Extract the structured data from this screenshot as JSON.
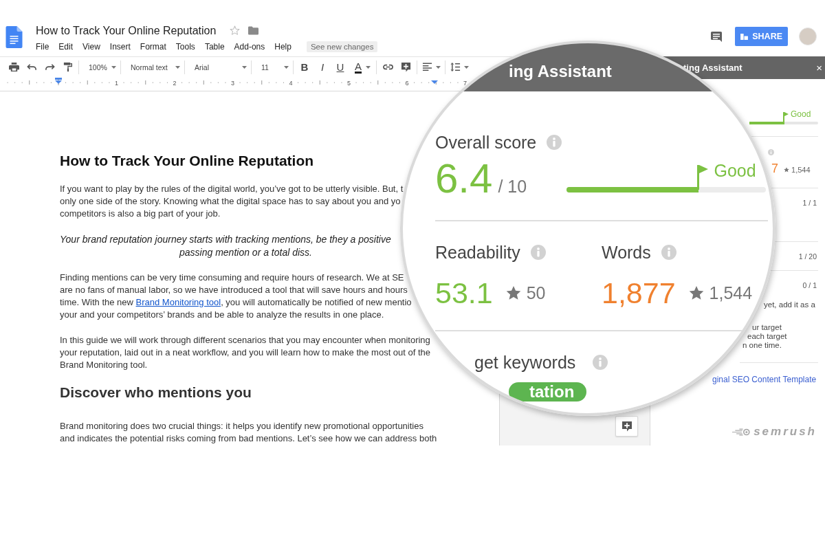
{
  "header": {
    "title": "How to Track Your Online Reputation",
    "starred": false,
    "menu": [
      "File",
      "Edit",
      "View",
      "Insert",
      "Format",
      "Tools",
      "Table",
      "Add-ons",
      "Help"
    ],
    "changes_button": "See new changes",
    "share_button": "SHARE"
  },
  "toolbar": {
    "zoom": "100%",
    "style": "Normal text",
    "font": "Arial",
    "size": "11",
    "format_buttons": [
      {
        "kind": "bold",
        "label": "B"
      },
      {
        "kind": "italic",
        "label": "I"
      },
      {
        "kind": "underline",
        "label": "U"
      },
      {
        "kind": "color",
        "label": "A"
      }
    ]
  },
  "ruler": {
    "numbers": [
      "1",
      "2",
      "3",
      "4",
      "5",
      "6",
      "7"
    ]
  },
  "document": {
    "blocks": [
      {
        "kind": "title",
        "text": "How to Track Your Online Reputation"
      },
      {
        "kind": "paragraph",
        "lines": [
          "If you want to play by the rules of the digital world, you’ve got to be utterly visible. But, t",
          "only one side of the story. Knowing what the digital space has to say about you and yo",
          "competitors is also a big part of your job."
        ]
      },
      {
        "kind": "quote",
        "lines": [
          "Your brand reputation journey starts with tracking mentions, be they a positive",
          "passing mention or a total diss."
        ]
      },
      {
        "kind": "paragraph",
        "lines": [
          "Finding mentions can be very time consuming and require hours of research. We at SE",
          "are no fans of manual labor, so we have introduced a tool that will save hours and hours",
          [
            {
              "kind": "text",
              "text": "time. With the new "
            },
            {
              "kind": "link",
              "text": "Brand Monitoring tool"
            },
            {
              "kind": "text",
              "text": ", you will automatically be notified of new mentio"
            }
          ],
          "your and your competitors’ brands and be able to analyze the results in one place."
        ]
      },
      {
        "kind": "paragraph",
        "lines": [
          "In this guide we will work through different scenarios that you may encounter when monitoring",
          "your reputation, laid out in a neat workflow, and you will learn how to make the most out of the",
          "Brand Monitoring tool."
        ]
      },
      {
        "kind": "heading",
        "text": "Discover who mentions you"
      },
      {
        "kind": "paragraph",
        "lines": [
          "Brand monitoring does two crucial things: it helps you identify new promotional opportunities",
          "and indicates the potential risks coming from bad mentions. Let’s see how we can address both"
        ]
      }
    ]
  },
  "side_panel": {
    "title": "ting Assistant",
    "close": "×",
    "score": {
      "level": 0.5,
      "rating": "Good"
    },
    "words": {
      "value": "7",
      "target": "1,544"
    },
    "rows": [
      {
        "count": "1 / 1"
      },
      {
        "count": "1 / 20"
      },
      {
        "count": "0 / 1",
        "hint": [
          [
            "yet, add it as a"
          ],
          [
            "ur target",
            "each target",
            "n one time."
          ]
        ]
      }
    ],
    "link": "ginal SEO Content Template",
    "logo": "semrush"
  },
  "magnifier": {
    "title": "ing Assistant",
    "overall": {
      "label": "Overall score",
      "value": "6.4",
      "max": "/ 10",
      "level": 0.66,
      "rating": "Good"
    },
    "metrics": [
      {
        "label": "Readability",
        "value": "53.1",
        "color": "#7cc142",
        "target": "50"
      },
      {
        "label": "Words",
        "value": "1,877",
        "color": "#f0812f",
        "target": "1,544"
      }
    ],
    "keywords": {
      "label": "get keywords",
      "tags": [
        "tation"
      ]
    }
  }
}
